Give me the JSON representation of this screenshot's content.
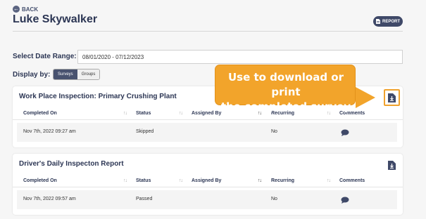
{
  "header": {
    "back_label": "BACK",
    "title": "Luke Skywalker",
    "report_label": "REPORT"
  },
  "filters": {
    "date_range_label": "Select Date Range:",
    "date_range_value": "08/01/2020 - 07/12/2023",
    "display_by_label": "Display by:",
    "display_options": [
      "Surveys",
      "Groups"
    ],
    "display_selected": "Surveys"
  },
  "columns": [
    "Completed On",
    "Status",
    "Assigned By",
    "Recurring",
    "Comments"
  ],
  "surveys": [
    {
      "title": "Work Place Inspection: Primary Crushing Plant",
      "completed_on": "Nov 7th, 2022 09:27 am",
      "status": "Skipped",
      "assigned_by": "",
      "recurring": "No"
    },
    {
      "title": "Driver's Daily Inspecton Report",
      "completed_on": "Nov 7th, 2022 09:57 am",
      "status": "Passed",
      "assigned_by": "",
      "recurring": "No"
    }
  ],
  "callout": {
    "line1": "Use to download or print",
    "line2": "the completed survey"
  },
  "icons": {
    "back": "arrow-left-circle-icon",
    "report": "file-icon",
    "download": "file-download-icon",
    "comment": "comment-icon",
    "sort": "sort-arrows-icon"
  },
  "colors": {
    "primary": "#3f4968",
    "callout": "#f2a42b",
    "background": "#f6f6f6"
  }
}
